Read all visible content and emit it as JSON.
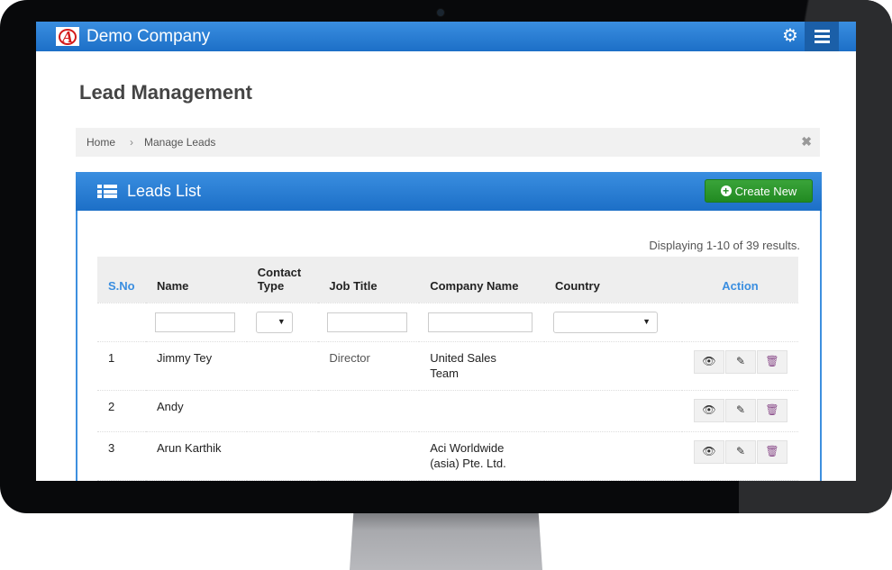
{
  "app": {
    "brand": "Demo Company"
  },
  "header": {
    "settings_icon": "gear-icon",
    "menu_icon": "hamburger-icon"
  },
  "page": {
    "title": "Lead Management"
  },
  "breadcrumb": {
    "home": "Home",
    "separator": "›",
    "current": "Manage Leads",
    "close": "✖"
  },
  "panel": {
    "title": "Leads List",
    "create_label": "Create New",
    "summary": "Displaying 1-10 of 39 results."
  },
  "table": {
    "headers": {
      "sno": "S.No",
      "name": "Name",
      "contact_type_1": "Contact",
      "contact_type_2": "Type",
      "job_title": "Job Title",
      "company": "Company Name",
      "country": "Country",
      "action": "Action"
    },
    "filters": {
      "name": "",
      "contact_type": "",
      "job_title": "",
      "company": "",
      "country": ""
    },
    "rows": [
      {
        "sno": "1",
        "name": "Jimmy Tey",
        "contact_type": "",
        "job_title": "Director",
        "company_1": "United Sales",
        "company_2": "Team",
        "country": ""
      },
      {
        "sno": "2",
        "name": "Andy",
        "contact_type": "",
        "job_title": "",
        "company_1": "",
        "company_2": "",
        "country": ""
      },
      {
        "sno": "3",
        "name": "Arun Karthik",
        "contact_type": "",
        "job_title": "",
        "company_1": "Aci Worldwide",
        "company_2": "(asia) Pte. Ltd.",
        "country": ""
      }
    ]
  },
  "colors": {
    "primary": "#1c6fc7",
    "success": "#218a21",
    "link": "#3a8ee0"
  }
}
